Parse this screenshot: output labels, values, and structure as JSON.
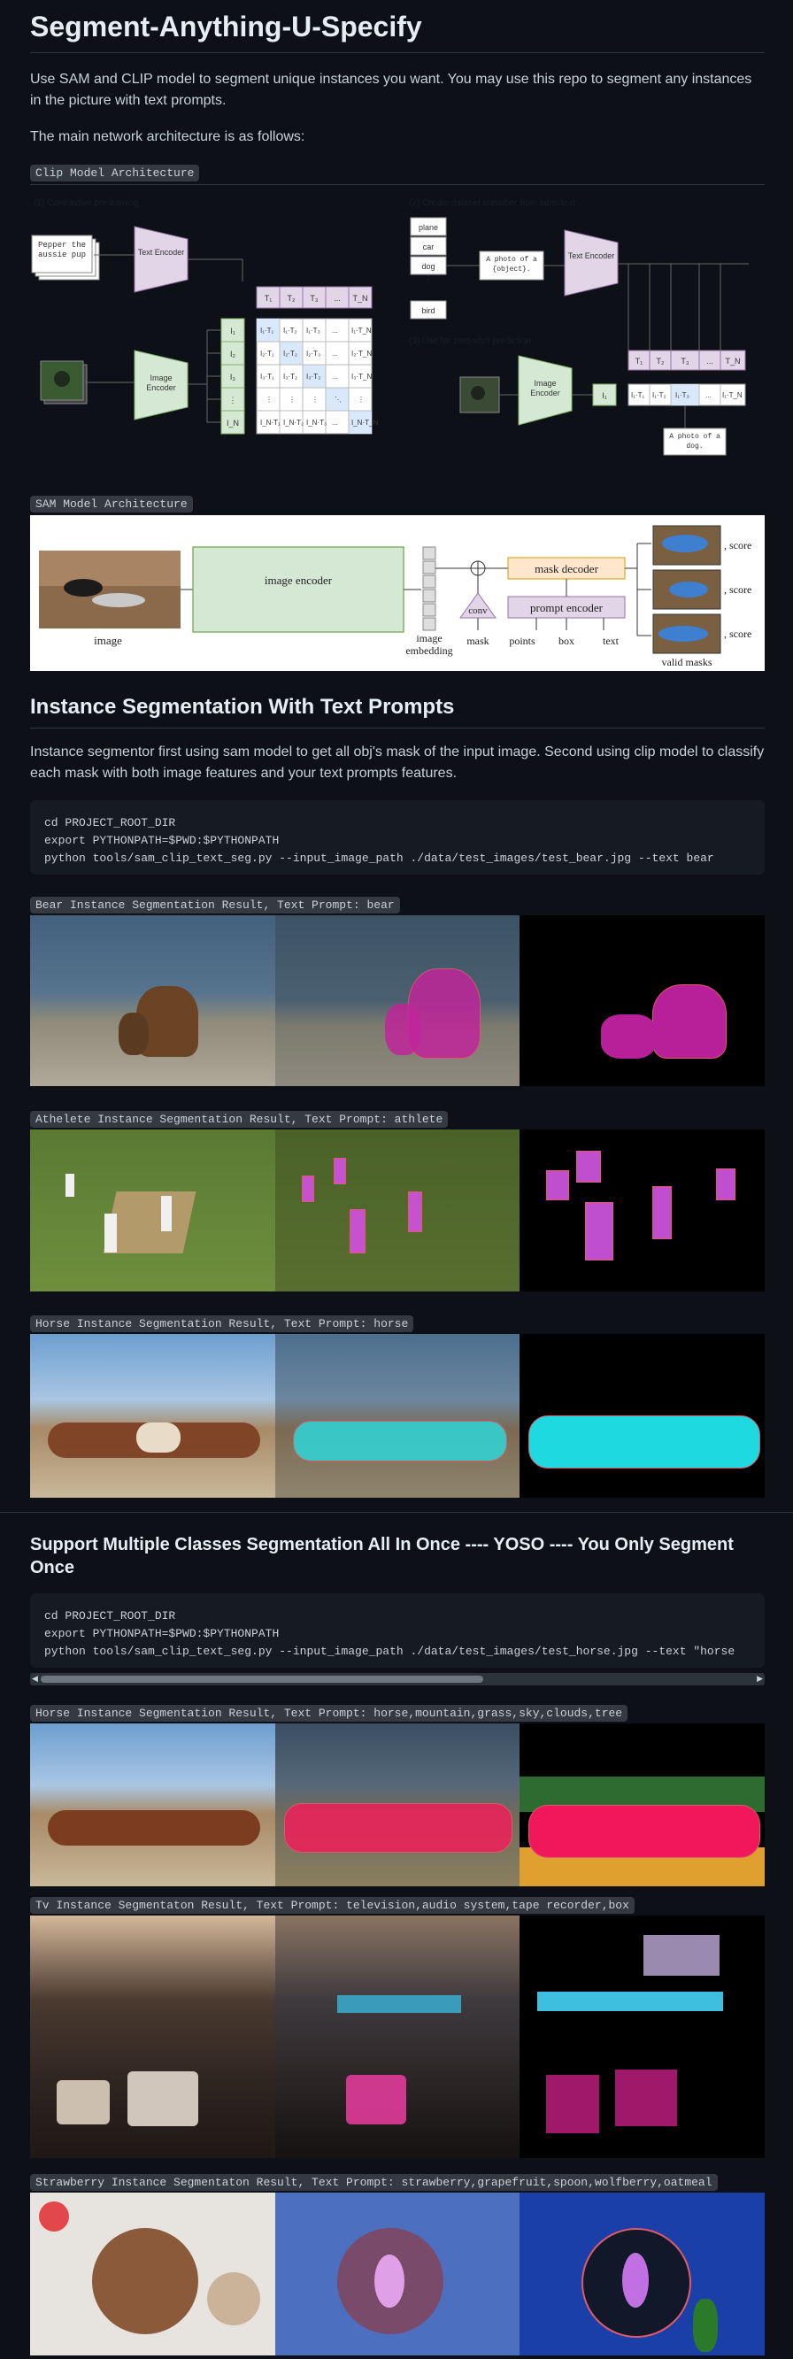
{
  "title": "Segment-Anything-U-Specify",
  "intro": "Use SAM and CLIP model to segment unique instances you want. You may use this repo to segment any instances in the picture with text prompts.",
  "arch_intro": "The main network architecture is as follows:",
  "clip_caption": "Clip Model Architecture",
  "clip_figure": {
    "heading_left": "(1) Contrastive pre-training",
    "heading_right": "(2) Create dataset classifier from label text",
    "heading_right2": "(3) Use for zero-shot prediction",
    "text_card": "Pepper the aussie pup",
    "text_encoder": "Text Encoder",
    "image_encoder": "Image Encoder",
    "labels": [
      "plane",
      "car",
      "dog",
      "bird"
    ],
    "prompt": "A photo of a {object}.",
    "prompt_result": "A photo of a dog.",
    "t_labels": [
      "T₁",
      "T₂",
      "T₃",
      "...",
      "T_N"
    ],
    "i_labels": [
      "I₁",
      "I₂",
      "I₃",
      "⋮",
      "I_N"
    ]
  },
  "sam_caption": "SAM Model Architecture",
  "sam_figure": {
    "image_label": "image",
    "encoder_label": "image encoder",
    "embedding_label": "image embedding",
    "mask_label": "mask",
    "points_label": "points",
    "box_label": "box",
    "text_label": "text",
    "conv_label": "conv",
    "mask_decoder": "mask decoder",
    "prompt_encoder": "prompt encoder",
    "score_labels": [
      ", score",
      ", score",
      ", score"
    ],
    "valid_masks": "valid masks"
  },
  "section1_title": "Instance Segmentation With Text Prompts",
  "section1_text": "Instance segmentor first using sam model to get all obj's mask of the input image. Second using clip model to classify each mask with both image features and your text prompts features.",
  "code1": [
    "cd PROJECT_ROOT_DIR",
    "export PYTHONPATH=$PWD:$PYTHONPATH",
    "python tools/sam_clip_text_seg.py --input_image_path ./data/test_images/test_bear.jpg --text bear"
  ],
  "result_captions": [
    "Bear Instance Segmentation Result, Text Prompt: bear",
    "Athelete Instance Segmentation Result, Text Prompt: athlete",
    "Horse Instance Segmentation Result, Text Prompt: horse"
  ],
  "section2_title": "Support Multiple Classes Segmentation All In Once ---- YOSO ---- You Only Segment Once",
  "code2": [
    "cd PROJECT_ROOT_DIR",
    "export PYTHONPATH=$PWD:$PYTHONPATH",
    "python tools/sam_clip_text_seg.py --input_image_path ./data/test_images/test_horse.jpg --text \"horse"
  ],
  "result_captions2": [
    "Horse Instance Segmentation Result, Text Prompt: horse,mountain,grass,sky,clouds,tree",
    "Tv Instance Segmentaton Result, Text Prompt: television,audio system,tape recorder,box",
    "Strawberry Instance Segmentaton Result, Text Prompt: strawberry,grapefruit,spoon,wolfberry,oatmeal"
  ],
  "colors": {
    "bg": "#0d1117",
    "text": "#c9d1d9",
    "heading": "#e6edf3",
    "code_bg": "#161b22",
    "inline_code_bg": "#343942",
    "magenta": "#c0259a",
    "cyan": "#2fd6d6",
    "pink_red": "#e8245a"
  }
}
